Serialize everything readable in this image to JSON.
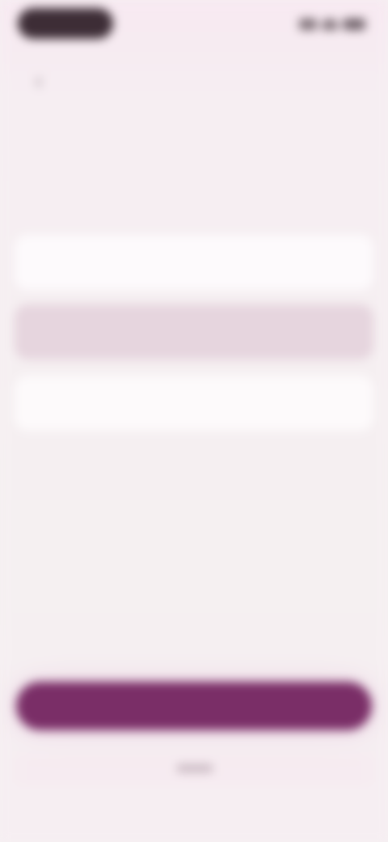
{
  "status_bar": {
    "time": "",
    "icons": [
      "signal-icon",
      "wifi-icon",
      "battery-icon"
    ]
  },
  "header": {
    "back_icon": "back-arrow-icon",
    "back_glyph": "‹",
    "title": ""
  },
  "step_label": "",
  "question": {
    "title": "",
    "subtitle": ""
  },
  "options": [
    {
      "label": "",
      "selected": false
    },
    {
      "label": "",
      "selected": true
    },
    {
      "label": "",
      "selected": false
    }
  ],
  "primary_button": {
    "label": ""
  },
  "colors": {
    "accent": "#7a2e67",
    "selected_option": "#e6d5de",
    "background": "#f6f0f2"
  }
}
